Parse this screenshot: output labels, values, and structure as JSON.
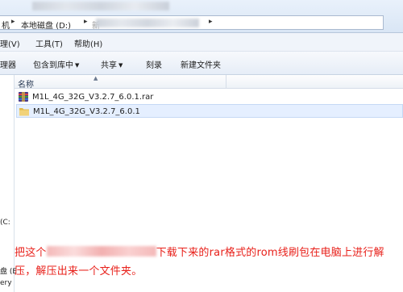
{
  "address_bar": {
    "left_glyph": "机",
    "drive_label": "本地磁盘 (D:)",
    "blurred_char": "新"
  },
  "menu": {
    "items": [
      "理(V)",
      "工具(T)",
      "帮助(H)"
    ]
  },
  "toolbar": {
    "items": [
      "理器",
      "包含到库中",
      "共享",
      "刻录",
      "新建文件夹"
    ]
  },
  "nav_pane": {
    "labels": [
      "(C:",
      "盘 (E",
      "ery"
    ]
  },
  "file_list": {
    "column_name": "名称",
    "files": [
      {
        "name": "M1L_4G_32G_V3.2.7_6.0.1.rar",
        "icon": "rar-archive-icon"
      },
      {
        "name": "M1L_4G_32G_V3.2.7_6.0.1",
        "icon": "folder-icon",
        "selected": true
      }
    ]
  },
  "annotation": {
    "line1_before": "把这个",
    "line1_after": "下载下来的rar格式的rom线刷包在电脑上进行解",
    "line2": "压，解压出来一个文件夹。"
  },
  "colors": {
    "annotation_text": "#e8201a",
    "selection_bg": "#e5efff",
    "toolbar_bg": "#e6edf7"
  }
}
